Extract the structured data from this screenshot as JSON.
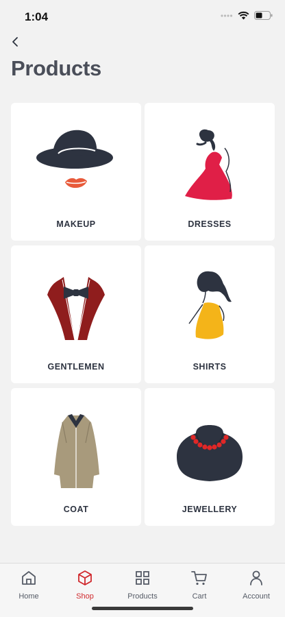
{
  "status": {
    "time": "1:04"
  },
  "page": {
    "title": "Products"
  },
  "categories": [
    {
      "label": "MAKEUP",
      "icon": "woman-hat-icon"
    },
    {
      "label": "DRESSES",
      "icon": "red-dress-icon"
    },
    {
      "label": "GENTLEMEN",
      "icon": "tuxedo-icon"
    },
    {
      "label": "SHIRTS",
      "icon": "yellow-dress-icon"
    },
    {
      "label": "COAT",
      "icon": "coat-icon"
    },
    {
      "label": "JEWELLERY",
      "icon": "necklace-icon"
    }
  ],
  "nav": [
    {
      "label": "Home",
      "icon": "home-icon",
      "active": false
    },
    {
      "label": "Shop",
      "icon": "cube-icon",
      "active": true
    },
    {
      "label": "Products",
      "icon": "grid-icon",
      "active": false
    },
    {
      "label": "Cart",
      "icon": "cart-icon",
      "active": false
    },
    {
      "label": "Account",
      "icon": "user-icon",
      "active": false
    }
  ],
  "colors": {
    "accent": "#d0282c",
    "background": "#f2f2f2",
    "card": "#ffffff",
    "text": "#2d3340"
  }
}
